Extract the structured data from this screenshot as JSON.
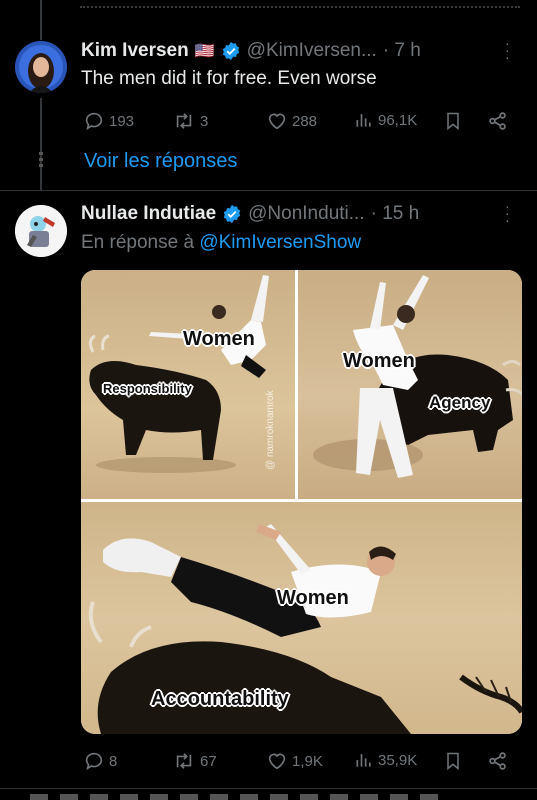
{
  "tweet1": {
    "name": "Kim Iversen",
    "flag": "🇺🇸",
    "handle": "@KimIversen...",
    "time": "· 7 h",
    "text": "The men did it for free. Even worse",
    "replies": "193",
    "retweets": "3",
    "likes": "288",
    "views": "96,1K"
  },
  "show_replies": "Voir les réponses",
  "tweet2": {
    "name": "Nullae Indutiae",
    "handle": "@NonInduti...",
    "time": "· 15 h",
    "reply_prefix": "En réponse à ",
    "reply_to": "@KimIversenShow",
    "replies": "8",
    "retweets": "67",
    "likes": "1,9K",
    "views": "35,9K"
  },
  "meme": {
    "panel1_women": "Women",
    "panel1_bull": "Responsibility",
    "watermark": "@ namroknamrok",
    "panel2_women": "Women",
    "panel2_bull": "Agency",
    "panel3_women": "Women",
    "panel3_bull": "Accountability"
  },
  "colors": {
    "background": "#000000",
    "accent": "#1d9bf0",
    "muted": "#71767b",
    "text": "#e7e9ea",
    "sand": "#d8bf93"
  },
  "icons": [
    "reply-icon",
    "retweet-icon",
    "like-icon",
    "views-icon",
    "bookmark-icon",
    "share-icon",
    "verified-icon",
    "more-icon"
  ]
}
